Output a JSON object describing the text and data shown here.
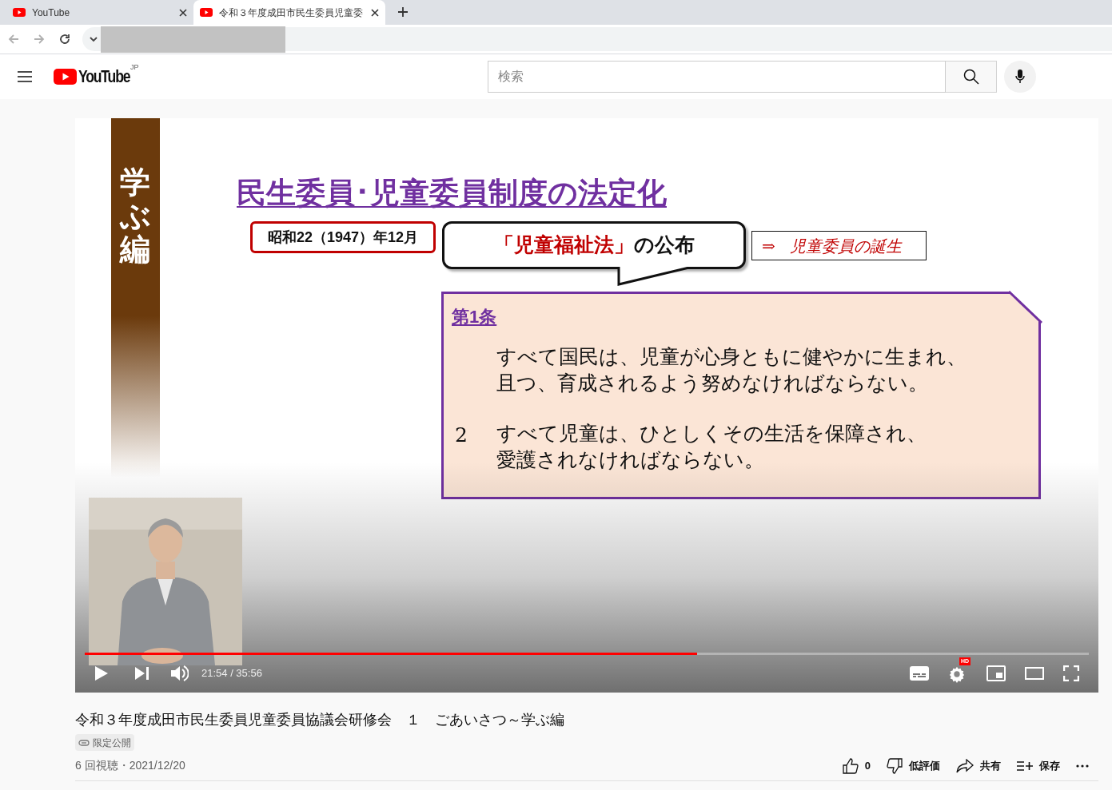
{
  "browser": {
    "tabs": [
      {
        "title": "YouTube",
        "selected": false
      },
      {
        "title": "令和３年度成田市民生委員児童委",
        "selected": true
      }
    ]
  },
  "header": {
    "logo": "YouTube",
    "region": "JP",
    "search": {
      "placeholder": "検索"
    }
  },
  "video": {
    "slide": {
      "side_label": "学ぶ編",
      "title": "民生委員･児童委員制度の法定化",
      "date": "昭和22（1947）年12月",
      "callout_emphasis": "「児童福祉法」",
      "callout_rest": "の公布",
      "result_arrow": "⇒",
      "result": "児童委員の誕生",
      "article": {
        "heading": "第1条",
        "paragraphs": [
          {
            "lines": [
              "すべて国民は、児童が心身ともに健やかに生まれ、",
              "且つ、育成されるよう努めなければならない。"
            ]
          },
          {
            "number": "2",
            "lines": [
              "すべて児童は、ひとしくその生活を保障され、",
              "愛護されなければならない。"
            ]
          }
        ]
      }
    },
    "progress": {
      "level": 0.61
    },
    "time": "21:54 / 35:56",
    "quality_badge": "HD"
  },
  "info": {
    "title": "令和３年度成田市民生委員児童委員協議会研修会　１　ごあいさつ～学ぶ編",
    "visibility": "限定公開",
    "meta": "6 回視聴・2021/12/20",
    "actions": [
      {
        "kind": "like",
        "label": "0"
      },
      {
        "kind": "dislike",
        "label": "低評価"
      },
      {
        "kind": "share",
        "label": "共有"
      },
      {
        "kind": "save",
        "label": "保存"
      },
      {
        "kind": "more"
      }
    ]
  }
}
